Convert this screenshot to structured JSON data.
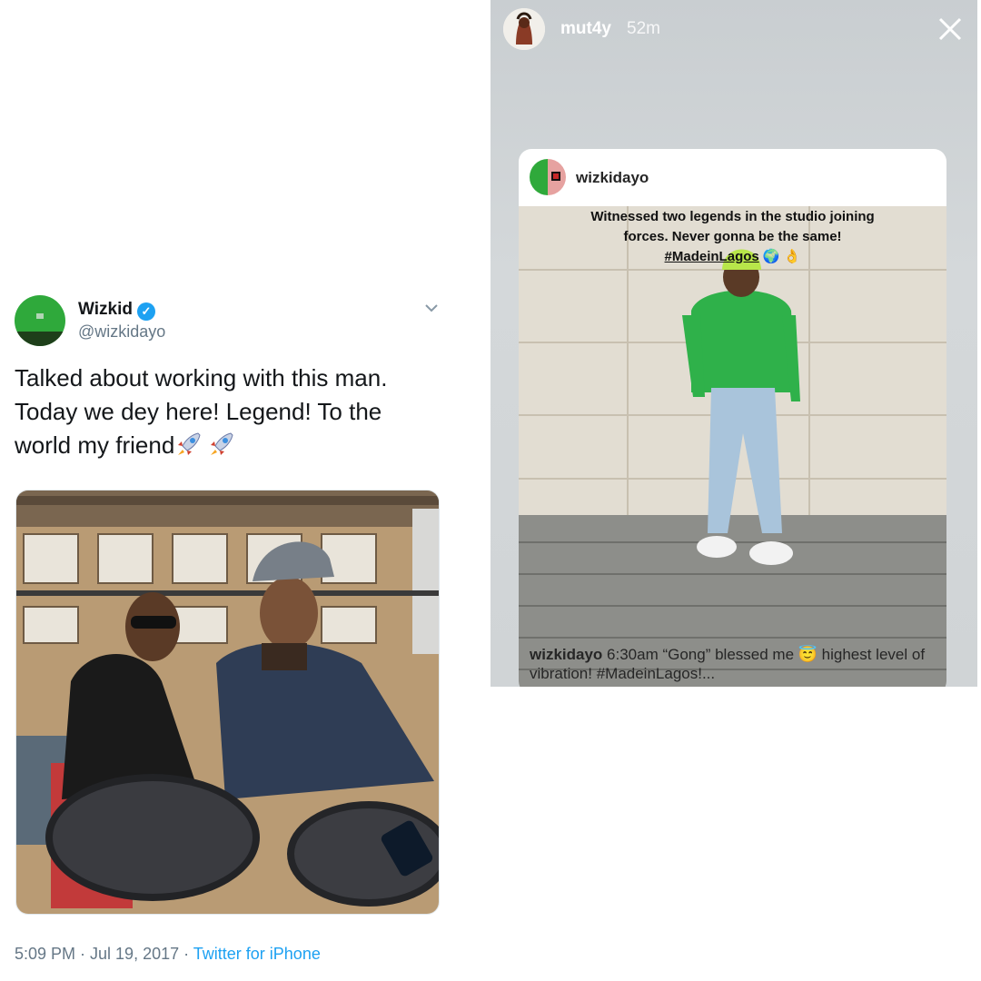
{
  "tweet": {
    "name": "Wizkid",
    "verified_glyph": "✓",
    "handle": "@wizkidayo",
    "text": "Talked about working with this man. Today we dey here! Legend! To the world my friend",
    "emoji_icons": [
      "rocket-icon",
      "rocket-icon"
    ],
    "timestamp": "5:09 PM · Jul 19, 2017 · ",
    "source": "Twitter for iPhone"
  },
  "story": {
    "username": "mut4y",
    "time_ago": "52m",
    "shared_post": {
      "username": "wizkidayo",
      "overlay": {
        "line1": "Witnessed two legends in the studio joining",
        "line2": "forces. Never gonna be the same!",
        "hashtag": "#MadeinLagos",
        "emoji": "🌍 👌"
      },
      "caption_user": "wizkidayo",
      "caption_text": " 6:30am “Gong” blessed me 😇 highest level of vibration! #MadeinLagos!..."
    }
  },
  "colors": {
    "twitter_blue": "#1da1f2",
    "muted_gray": "#657786",
    "avatar_green": "#2fa93b"
  }
}
